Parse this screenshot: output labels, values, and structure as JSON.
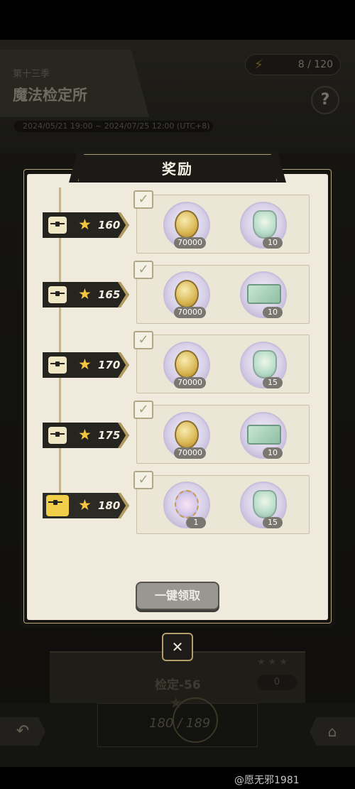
{
  "background": {
    "season_subtitle": "第十三季",
    "season_title": "魔法检定所",
    "date_range": "2024/05/21 19:00 ~ 2024/07/25 12:00 (UTC+8)",
    "energy": "8 / 120",
    "help_label": "?",
    "stage_name": "检定-56",
    "stage_score": "0",
    "progress": "180 / 189",
    "watermark": "@愿无邪1981"
  },
  "modal": {
    "title": "奖励",
    "claim_all_label": "一键领取",
    "close_label": "✕",
    "tiers": [
      {
        "stars": "160",
        "claimed": true,
        "rewards": [
          {
            "icon": "coin",
            "qty": "70000"
          },
          {
            "icon": "crystal-bottle",
            "qty": "10"
          }
        ]
      },
      {
        "stars": "165",
        "claimed": true,
        "rewards": [
          {
            "icon": "coin",
            "qty": "70000"
          },
          {
            "icon": "ticket",
            "qty": "10"
          }
        ]
      },
      {
        "stars": "170",
        "claimed": true,
        "rewards": [
          {
            "icon": "coin",
            "qty": "70000"
          },
          {
            "icon": "crystal-bottle",
            "qty": "15"
          }
        ]
      },
      {
        "stars": "175",
        "claimed": true,
        "rewards": [
          {
            "icon": "coin",
            "qty": "70000"
          },
          {
            "icon": "ticket",
            "qty": "10"
          }
        ]
      },
      {
        "stars": "180",
        "claimed": true,
        "rewards": [
          {
            "icon": "star-orb",
            "qty": "1"
          },
          {
            "icon": "crystal-bottle",
            "qty": "15"
          }
        ]
      }
    ]
  },
  "colors": {
    "panel": "#efeadc",
    "frame_gold": "#b8a779",
    "star_gold": "#f4c542",
    "dark_badge": "#26241f"
  }
}
